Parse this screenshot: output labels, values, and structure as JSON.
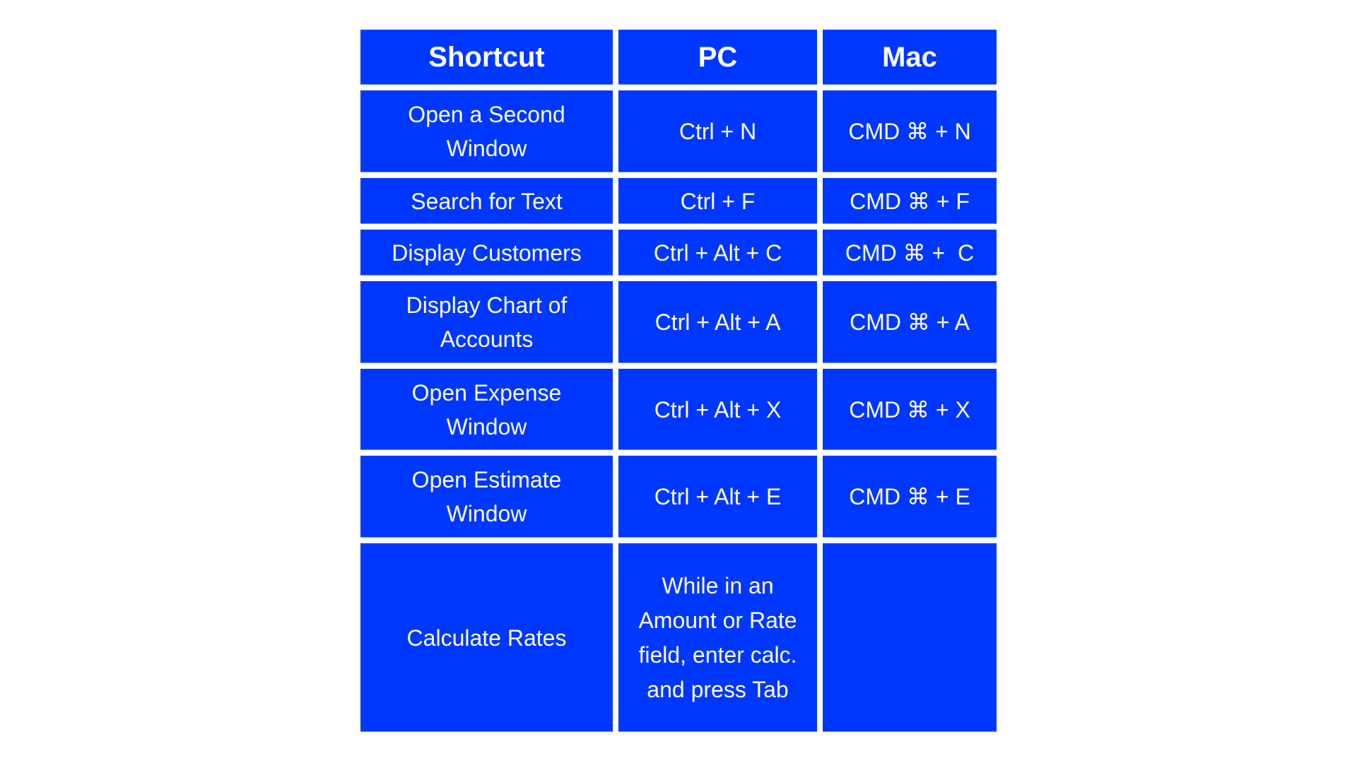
{
  "colors": {
    "cell_background": "#0037ff",
    "text": "#ffffff",
    "page_background": "#ffffff"
  },
  "table": {
    "headers": [
      "Shortcut",
      "PC",
      "Mac"
    ],
    "rows": [
      {
        "shortcut": "Open a Second Window",
        "pc": "Ctrl + N",
        "mac": "CMD ⌘ + N"
      },
      {
        "shortcut": "Search for Text",
        "pc": "Ctrl + F",
        "mac": "CMD ⌘ + F"
      },
      {
        "shortcut": "Display Customers",
        "pc": "Ctrl + Alt + C",
        "mac": "CMD ⌘ +  C"
      },
      {
        "shortcut": "Display Chart of Accounts",
        "pc": "Ctrl + Alt + A",
        "mac": "CMD ⌘ + A"
      },
      {
        "shortcut": "Open Expense Window",
        "pc": "Ctrl + Alt + X",
        "mac": "CMD ⌘ + X"
      },
      {
        "shortcut": "Open Estimate Window",
        "pc": "Ctrl + Alt + E",
        "mac": "CMD ⌘ + E"
      },
      {
        "shortcut": "Calculate Rates",
        "pc": "While in an Amount or Rate field, enter calc. and press Tab",
        "mac": ""
      }
    ]
  }
}
